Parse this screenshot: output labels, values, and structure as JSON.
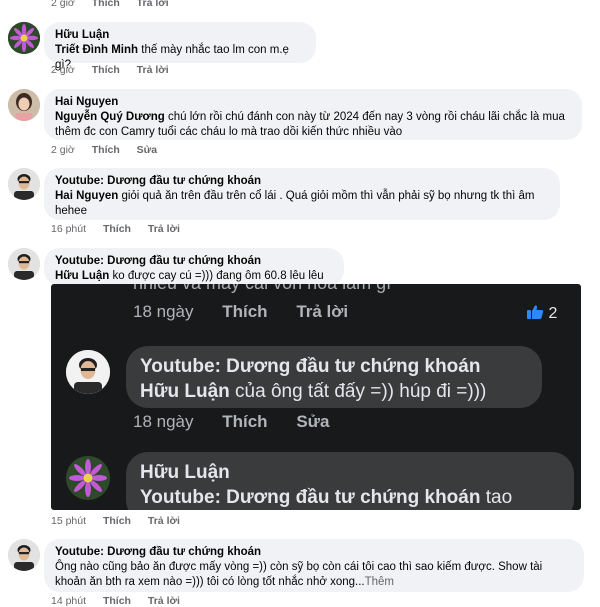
{
  "top_actions": {
    "time": "2 giờ",
    "like": "Thích",
    "reply": "Trả lời"
  },
  "comments": [
    {
      "author": "Hữu Luận",
      "mention": "Triết Đình Minh",
      "text": " thế mày nhắc tao lm con m.ẹ gì?",
      "time": "2 giờ",
      "like": "Thích",
      "reply": "Trả lời"
    },
    {
      "author": "Hai Nguyen",
      "mention": "Nguyễn Quý Dương",
      "text_line1": " chú lớn rồi chú đánh con này từ 2024 đến nay 3 vòng rồi cháu lãi chắc là mua",
      "text_line2": "thêm đc con Camry tuổi các cháu lo mà trao dồi kiến thức nhiều vào",
      "time": "2 giờ",
      "like": "Thích",
      "edit": "Sửa"
    },
    {
      "author": "Youtube: Dương đầu tư chứng khoán",
      "mention": "Hai Nguyen",
      "text_line1": "  giỏi quả ăn trên đầu trên cổ lái . Quá giỏi mồm thì vẫn phải sỹ bọ nhưng tk thì âm",
      "text_line2": "hehee",
      "time": "16 phút",
      "like": "Thích",
      "reply": "Trả lời"
    },
    {
      "author": "Youtube: Dương đầu tư chứng khoán",
      "mention": "Hữu Luận",
      "text": "  ko được cay cú =))) đang ôm 60.8 lêu lêu",
      "time": "15 phút",
      "like": "Thích",
      "reply": "Trả lời"
    },
    {
      "author": "Youtube: Dương đầu tư chứng khoán",
      "text_line1": "Ông nào cũng bảo ăn được mấy vòng =)) còn sỹ bọ còn cái tôi cao thì sao kiếm được. Show tài",
      "text_line2": "khoản ăn bth ra xem nào =))) tôi có lòng tốt nhắc nhở xong...",
      "see_more": "Thêm",
      "time": "14 phút",
      "like": "Thích",
      "reply": "Trả lời"
    }
  ],
  "embedded_screenshot": {
    "faded_line": "nhiều và mấy cái vốn hóa lắm gì",
    "row1_time": "18 ngày",
    "row1_like": "Thích",
    "row1_reply": "Trả lời",
    "row1_likes_count": "2",
    "reply_author": "Youtube: Dương đầu tư chứng khoán",
    "reply_mention": "Hữu Luận",
    "reply_text": " của ông tất đấy =)) húp đi =)))",
    "row2_time": "18 ngày",
    "row2_like": "Thích",
    "row2_edit": "Sửa",
    "next_author": "Hữu Luận",
    "next_mention": "Youtube: Dương đầu tư chứng khoán",
    "next_text": "  tao"
  },
  "colors": {
    "bubble": "#f0f2f5",
    "meta": "#65676b",
    "like_blue": "#2d88ff",
    "dark_bg": "#18191a"
  }
}
